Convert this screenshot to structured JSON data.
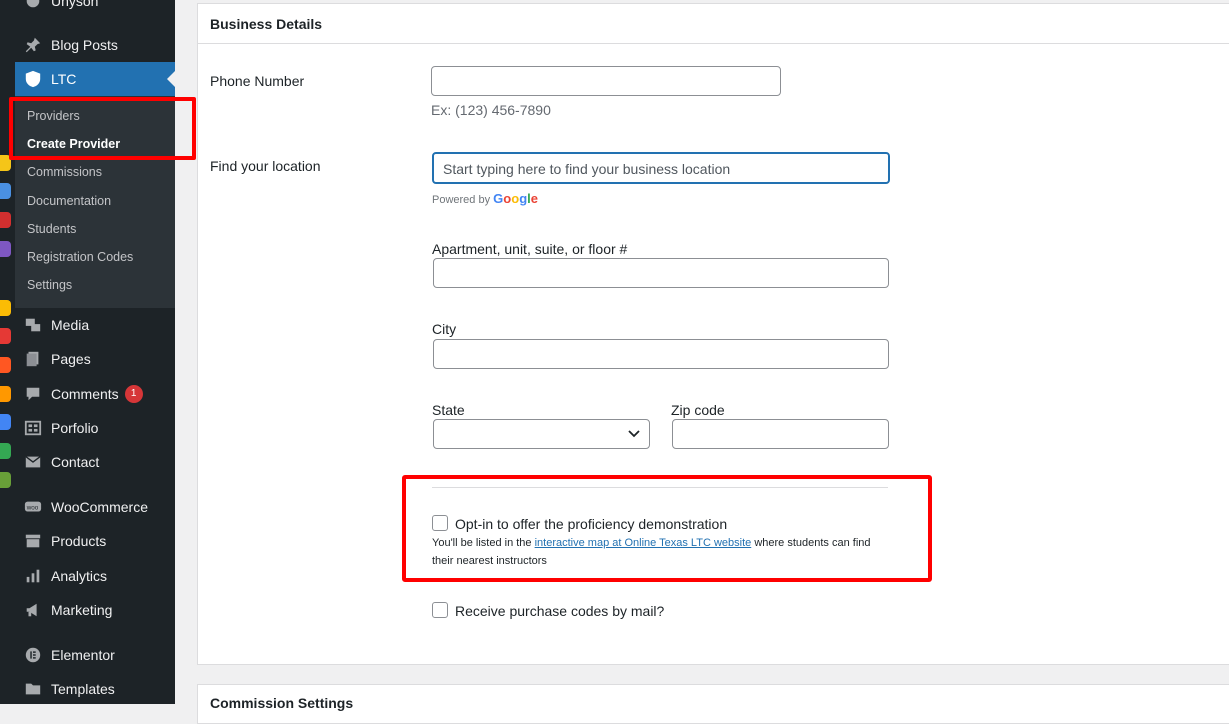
{
  "sidebar": {
    "top_partial": "Unyson",
    "blog_posts": "Blog Posts",
    "ltc": "LTC",
    "submenu": [
      "Providers",
      "Create Provider",
      "Commissions",
      "Documentation",
      "Students",
      "Registration Codes",
      "Settings"
    ],
    "media": "Media",
    "pages": "Pages",
    "comments": "Comments",
    "comments_badge": "1",
    "porfolio": "Porfolio",
    "contact": "Contact",
    "woocommerce": "WooCommerce",
    "products": "Products",
    "analytics": "Analytics",
    "marketing": "Marketing",
    "elementor": "Elementor",
    "templates": "Templates"
  },
  "panel": {
    "title": "Business Details",
    "phone_label": "Phone Number",
    "phone_hint": "Ex: (123) 456-7890",
    "location_label": "Find your location",
    "location_placeholder": "Start typing here to find your business location",
    "powered_by": "Powered by",
    "google": "Google",
    "apartment_label": "Apartment, unit, suite, or floor #",
    "city_label": "City",
    "state_label": "State",
    "zip_label": "Zip code",
    "optin_label": "Opt-in to offer the proficiency demonstration",
    "optin_desc_pre": "You'll be listed in the",
    "optin_link": "interactive map at Online Texas LTC website",
    "optin_desc_post": "where students can find their nearest instructors",
    "mail_label": "Receive purchase codes by mail?"
  },
  "panel2": {
    "title": "Commission Settings"
  },
  "colors": {
    "sidebar_bg": "#1d2327",
    "active_bg": "#2271b1",
    "highlight": "#ff0000"
  }
}
